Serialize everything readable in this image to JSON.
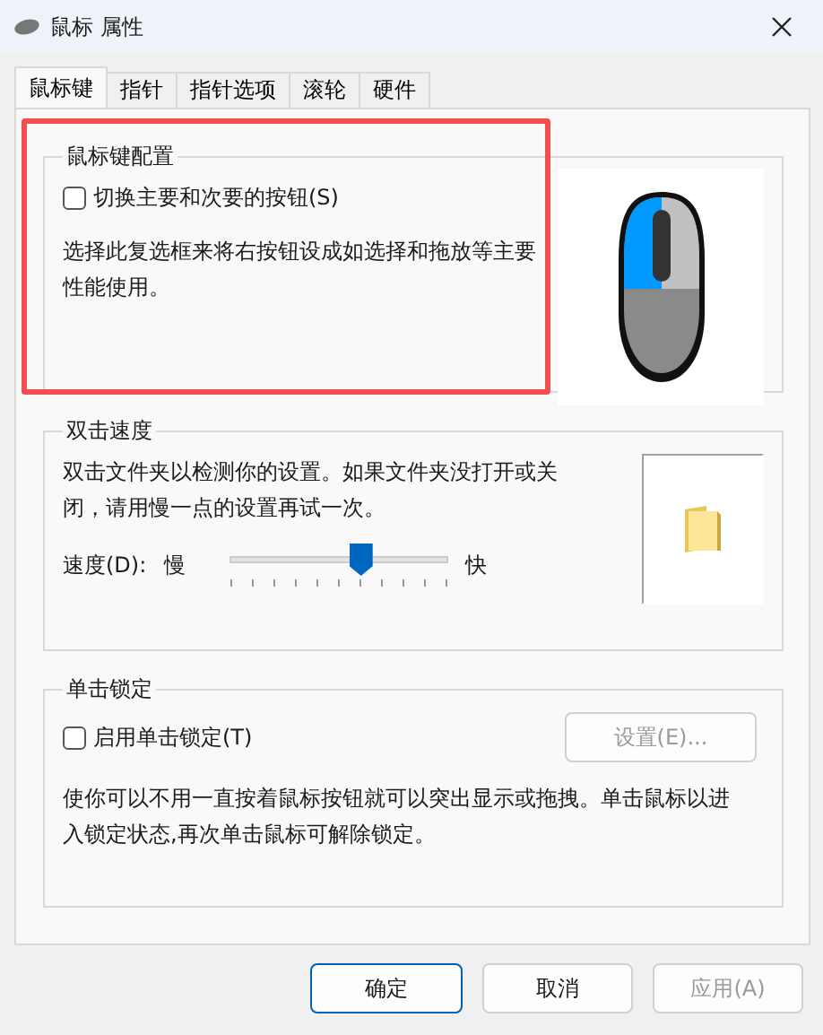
{
  "window": {
    "title": "鼠标 属性"
  },
  "tabs": [
    {
      "label": "鼠标键",
      "selected": true
    },
    {
      "label": "指针",
      "selected": false
    },
    {
      "label": "指针选项",
      "selected": false
    },
    {
      "label": "滚轮",
      "selected": false
    },
    {
      "label": "硬件",
      "selected": false
    }
  ],
  "button_config": {
    "title": "鼠标键配置",
    "checkbox": {
      "label": "切换主要和次要的按钮(S)",
      "checked": false
    },
    "description": "选择此复选框来将右按钮设成如选择和拖放等主要性能使用。"
  },
  "double_click": {
    "title": "双击速度",
    "description": "双击文件夹以检测你的设置。如果文件夹没打开或关闭，请用慢一点的设置再试一次。",
    "speed_label": "速度(D):",
    "slow": "慢",
    "fast": "快",
    "level": 0.6
  },
  "click_lock": {
    "title": "单击锁定",
    "checkbox": {
      "label": "启用单击锁定(T)",
      "checked": false
    },
    "settings_button": {
      "label": "设置(E)...",
      "disabled": true
    },
    "description": "使你可以不用一直按着鼠标按钮就可以突出显示或拖拽。单击鼠标以进入锁定状态,再次单击鼠标可解除锁定。"
  },
  "buttons": [
    {
      "label": "确定",
      "default": true,
      "disabled": false
    },
    {
      "label": "取消",
      "default": false,
      "disabled": false
    },
    {
      "label": "应用(A)",
      "default": false,
      "disabled": true
    }
  ]
}
